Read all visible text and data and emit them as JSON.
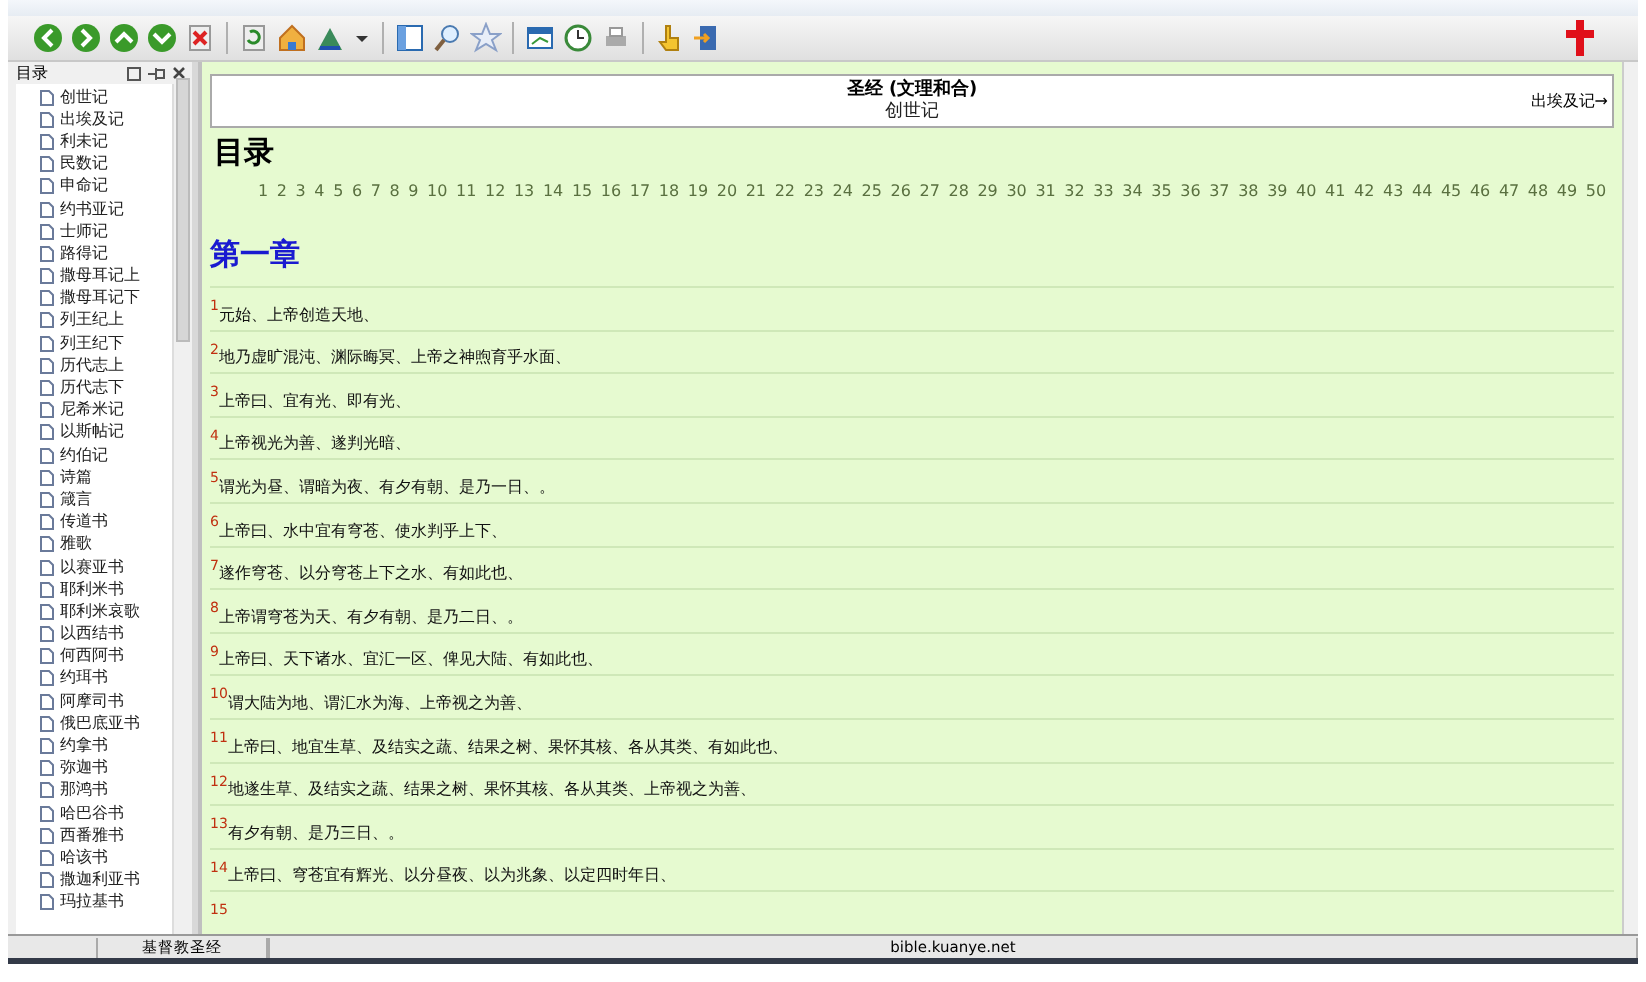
{
  "sidebar": {
    "title": "目录",
    "items": [
      "创世记",
      "出埃及记",
      "利未记",
      "民数记",
      "申命记",
      "约书亚记",
      "士师记",
      "路得记",
      "撒母耳记上",
      "撒母耳记下",
      "列王纪上",
      "列王纪下",
      "历代志上",
      "历代志下",
      "尼希米记",
      "以斯帖记",
      "约伯记",
      "诗篇",
      "箴言",
      "传道书",
      "雅歌",
      "以赛亚书",
      "耶利米书",
      "耶利米哀歌",
      "以西结书",
      "何西阿书",
      "约珥书",
      "阿摩司书",
      "俄巴底亚书",
      "约拿书",
      "弥迦书",
      "那鸿书",
      "哈巴谷书",
      "西番雅书",
      "哈该书",
      "撒迦利亚书",
      "玛拉基书"
    ]
  },
  "header": {
    "title": "圣经 (文理和合)",
    "subtitle": "创世记",
    "next_link": "出埃及记→"
  },
  "contents_heading": "目录",
  "chapter_links": [
    "1",
    "2",
    "3",
    "4",
    "5",
    "6",
    "7",
    "8",
    "9",
    "10",
    "11",
    "12",
    "13",
    "14",
    "15",
    "16",
    "17",
    "18",
    "19",
    "20",
    "21",
    "22",
    "23",
    "24",
    "25",
    "26",
    "27",
    "28",
    "29",
    "30",
    "31",
    "32",
    "33",
    "34",
    "35",
    "36",
    "37",
    "38",
    "39",
    "40",
    "41",
    "42",
    "43",
    "44",
    "45",
    "46",
    "47",
    "48",
    "49",
    "50"
  ],
  "chapter_heading": "第一章",
  "verses": [
    {
      "number": "1",
      "text": "元始、上帝创造天地、"
    },
    {
      "number": "2",
      "text": "地乃虚旷混沌、渊际晦冥、上帝之神煦育乎水面、"
    },
    {
      "number": "3",
      "text": "上帝曰、宜有光、即有光、"
    },
    {
      "number": "4",
      "text": "上帝视光为善、遂判光暗、"
    },
    {
      "number": "5",
      "text": "谓光为昼、谓暗为夜、有夕有朝、是乃一日、。"
    },
    {
      "number": "6",
      "text": "上帝曰、水中宜有穹苍、使水判乎上下、"
    },
    {
      "number": "7",
      "text": "遂作穹苍、以分穹苍上下之水、有如此也、"
    },
    {
      "number": "8",
      "text": "上帝谓穹苍为天、有夕有朝、是乃二日、。"
    },
    {
      "number": "9",
      "text": "上帝曰、天下诸水、宜汇一区、俾见大陆、有如此也、"
    },
    {
      "number": "10",
      "text": "谓大陆为地、谓汇水为海、上帝视之为善、"
    },
    {
      "number": "11",
      "text": "上帝曰、地宜生草、及结实之蔬、结果之树、果怀其核、各从其类、有如此也、"
    },
    {
      "number": "12",
      "text": "地遂生草、及结实之蔬、结果之树、果怀其核、各从其类、上帝视之为善、"
    },
    {
      "number": "13",
      "text": "有夕有朝、是乃三日、。"
    },
    {
      "number": "14",
      "text": "上帝曰、穹苍宜有辉光、以分昼夜、以为兆象、以定四时年日、"
    },
    {
      "number": "15"
    }
  ],
  "status_bar": [
    "基督教圣经",
    "bible.kuanye.net"
  ]
}
